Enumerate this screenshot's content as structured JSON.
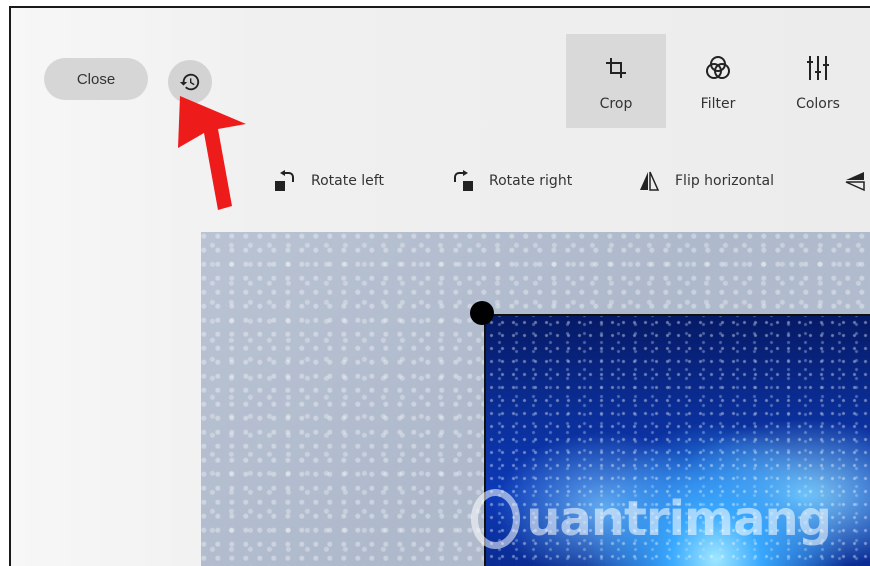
{
  "toolbar": {
    "close_label": "Close",
    "history_icon": "history-icon"
  },
  "modes": [
    {
      "label": "Crop",
      "icon": "crop-icon",
      "selected": true
    },
    {
      "label": "Filter",
      "icon": "filter-icon",
      "selected": false
    },
    {
      "label": "Colors",
      "icon": "colors-icon",
      "selected": false
    }
  ],
  "tools": [
    {
      "label": "Rotate left",
      "icon": "rotate-left-icon"
    },
    {
      "label": "Rotate right",
      "icon": "rotate-right-icon"
    },
    {
      "label": "Flip horizontal",
      "icon": "flip-horizontal-icon"
    },
    {
      "label": "",
      "icon": "flip-vertical-icon"
    }
  ],
  "watermark": {
    "text": "uantrimang"
  },
  "colors": {
    "annotation_arrow": "#ee1b1b",
    "selected_mode_bg": "#d9d9d9",
    "close_bg": "#d6d6d6"
  }
}
